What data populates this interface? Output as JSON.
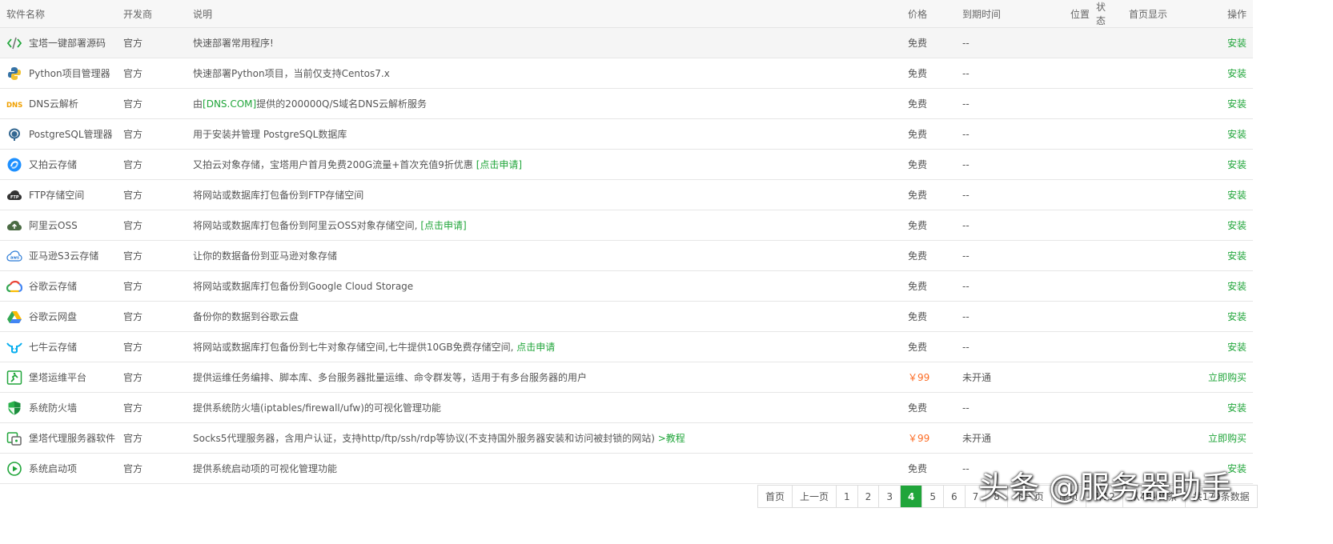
{
  "headers": {
    "name": "软件名称",
    "developer": "开发商",
    "desc": "说明",
    "price": "价格",
    "expire": "到期时间",
    "position": "位置",
    "status": "状态",
    "home": "首页显示",
    "op": "操作"
  },
  "rows": [
    {
      "icon": "code-icon",
      "name": "宝塔一键部署源码",
      "developer": "官方",
      "desc": "快速部署常用程序!",
      "desc_link": "",
      "price": "免费",
      "expire": "--",
      "op": "安装"
    },
    {
      "icon": "python-icon",
      "name": "Python项目管理器",
      "developer": "官方",
      "desc": "快速部署Python项目，当前仅支持Centos7.x",
      "desc_link": "",
      "price": "免费",
      "expire": "--",
      "op": "安装"
    },
    {
      "icon": "dns-icon",
      "name": "DNS云解析",
      "developer": "官方",
      "desc_pre": "由",
      "desc_link_mid": "[DNS.COM]",
      "desc_post": "提供的200000Q/S域名DNS云解析服务",
      "price": "免费",
      "expire": "--",
      "op": "安装"
    },
    {
      "icon": "postgresql-icon",
      "name": "PostgreSQL管理器",
      "developer": "官方",
      "desc": "用于安装并管理 PostgreSQL数据库",
      "desc_link": "",
      "price": "免费",
      "expire": "--",
      "op": "安装"
    },
    {
      "icon": "upyun-icon",
      "name": "又拍云存储",
      "developer": "官方",
      "desc": "又拍云对象存储，宝塔用户首月免费200G流量+首次充值9折优惠 ",
      "desc_link": "[点击申请]",
      "price": "免费",
      "expire": "--",
      "op": "安装"
    },
    {
      "icon": "ftp-cloud-icon",
      "name": "FTP存储空间",
      "developer": "官方",
      "desc": "将网站或数据库打包备份到FTP存储空间",
      "desc_link": "",
      "price": "免费",
      "expire": "--",
      "op": "安装"
    },
    {
      "icon": "aliyun-oss-icon",
      "name": "阿里云OSS",
      "developer": "官方",
      "desc": "将网站或数据库打包备份到阿里云OSS对象存储空间, ",
      "desc_link": "[点击申请]",
      "price": "免费",
      "expire": "--",
      "op": "安装"
    },
    {
      "icon": "aws-cloud-icon",
      "name": "亚马逊S3云存储",
      "developer": "官方",
      "desc": "让你的数据备份到亚马逊对象存储",
      "desc_link": "",
      "price": "免费",
      "expire": "--",
      "op": "安装"
    },
    {
      "icon": "google-cloud-icon",
      "name": "谷歌云存储",
      "developer": "官方",
      "desc": "将网站或数据库打包备份到Google Cloud Storage",
      "desc_link": "",
      "price": "免费",
      "expire": "--",
      "op": "安装"
    },
    {
      "icon": "google-drive-icon",
      "name": "谷歌云网盘",
      "developer": "官方",
      "desc": "备份你的数据到谷歌云盘",
      "desc_link": "",
      "price": "免费",
      "expire": "--",
      "op": "安装"
    },
    {
      "icon": "qiniu-icon",
      "name": "七牛云存储",
      "developer": "官方",
      "desc": "将网站或数据库打包备份到七牛对象存储空间,七牛提供10GB免费存储空间, ",
      "desc_link": "点击申请",
      "price": "免费",
      "expire": "--",
      "op": "安装"
    },
    {
      "icon": "ops-platform-icon",
      "name": "堡塔运维平台",
      "developer": "官方",
      "desc": "提供运维任务编排、脚本库、多台服务器批量运维、命令群发等，适用于有多台服务器的用户",
      "desc_link": "",
      "price": "￥99",
      "paid": true,
      "expire": "未开通",
      "op": "立即购买"
    },
    {
      "icon": "firewall-shield-icon",
      "name": "系统防火墙",
      "developer": "官方",
      "desc": "提供系统防火墙(iptables/firewall/ufw)的可视化管理功能",
      "desc_link": "",
      "price": "免费",
      "expire": "--",
      "op": "安装"
    },
    {
      "icon": "proxy-server-icon",
      "name": "堡塔代理服务器软件",
      "developer": "官方",
      "desc": "Socks5代理服务器，含用户认证，支持http/ftp/ssh/rdp等协议(不支持国外服务器安装和访问被封锁的网站) ",
      "desc_link": ">教程",
      "price": "￥99",
      "paid": true,
      "expire": "未开通",
      "op": "立即购买"
    },
    {
      "icon": "play-circle-icon",
      "name": "系统启动项",
      "developer": "官方",
      "desc": "提供系统启动项的可视化管理功能",
      "desc_link": "",
      "price": "免费",
      "expire": "--",
      "op": "安装"
    }
  ],
  "pager": {
    "items": [
      "首页",
      "上一页",
      "1",
      "2",
      "3",
      "4",
      "5",
      "6",
      "7",
      "8",
      "下一页",
      "尾页",
      "4/12",
      "从46-60条",
      "共179条数据"
    ],
    "current": "4"
  },
  "watermark": "头条 @服务器助手",
  "colors": {
    "accent": "#20a53a",
    "paid": "#fc6d26"
  }
}
